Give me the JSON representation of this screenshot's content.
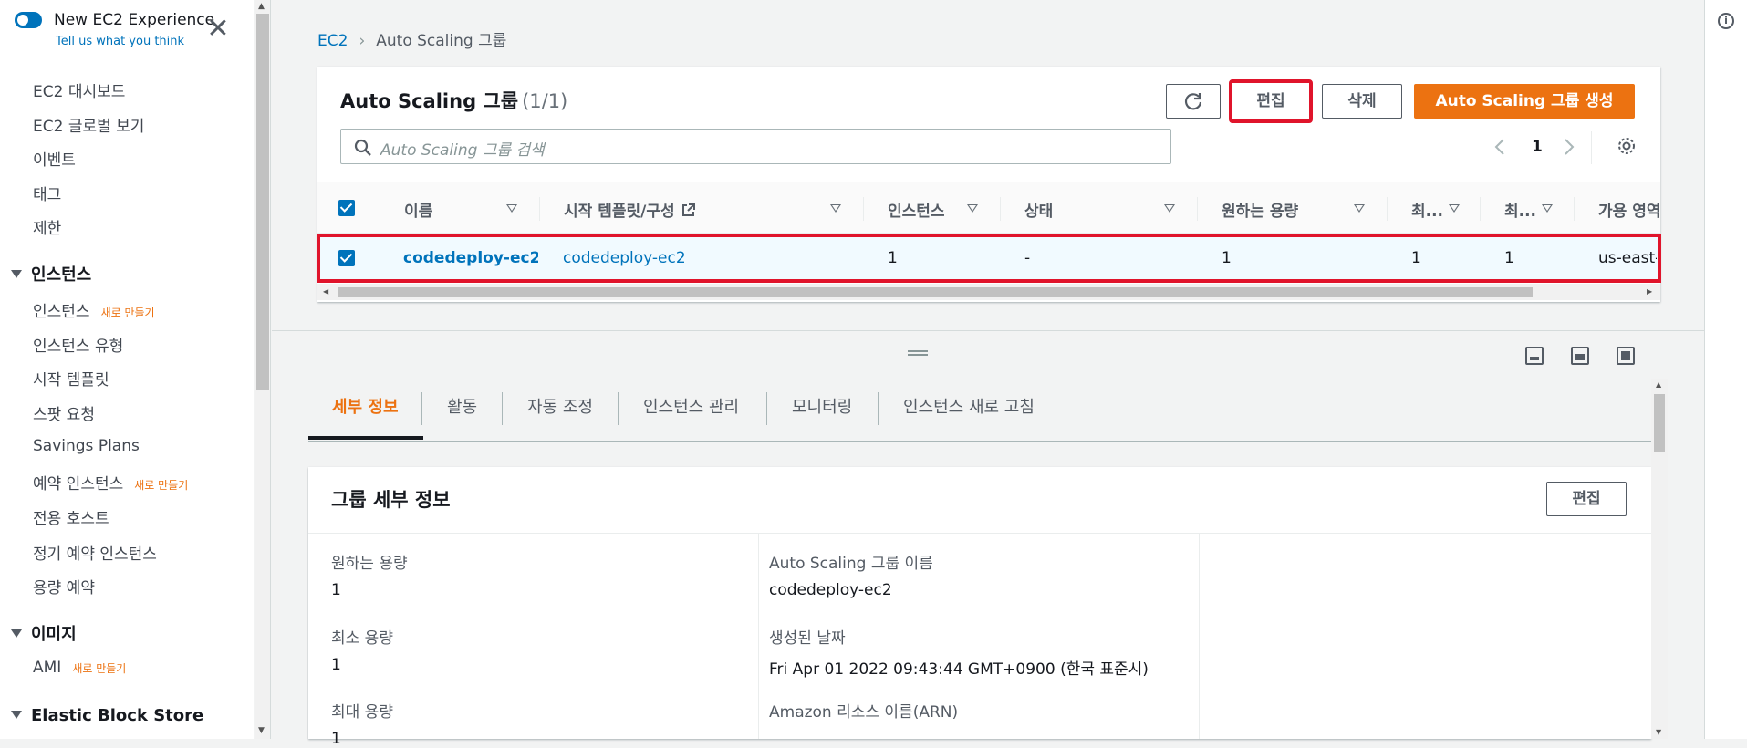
{
  "experience": {
    "title": "New EC2 Experience",
    "subtitle": "Tell us what you think",
    "close": "✕"
  },
  "nav": {
    "top_items": [
      "EC2 대시보드",
      "EC2 글로벌 보기",
      "이벤트",
      "태그",
      "제한"
    ],
    "instances_section": "인스턴스",
    "instances_items": [
      {
        "label": "인스턴스",
        "badge": "새로 만들기"
      },
      {
        "label": "인스턴스 유형",
        "badge": ""
      },
      {
        "label": "시작 템플릿",
        "badge": ""
      },
      {
        "label": "스팟 요청",
        "badge": ""
      },
      {
        "label": "Savings Plans",
        "badge": ""
      },
      {
        "label": "예약 인스턴스",
        "badge": "새로 만들기"
      },
      {
        "label": "전용 호스트",
        "badge": ""
      },
      {
        "label": "정기 예약 인스턴스",
        "badge": ""
      },
      {
        "label": "용량 예약",
        "badge": ""
      }
    ],
    "images_section": "이미지",
    "images_items": [
      {
        "label": "AMI",
        "badge": "새로 만들기"
      }
    ],
    "ebs_section": "Elastic Block Store"
  },
  "breadcrumb": {
    "root": "EC2",
    "current": "Auto Scaling 그룹"
  },
  "panel": {
    "title": "Auto Scaling 그룹",
    "count": "(1/1)",
    "edit_label": "편집",
    "delete_label": "삭제",
    "create_label": "Auto Scaling 그룹 생성",
    "search_placeholder": "Auto Scaling 그룹 검색",
    "page": "1"
  },
  "table": {
    "columns": [
      "이름",
      "시작 템플릿/구성",
      "인스턴스",
      "상태",
      "원하는 용량",
      "최...",
      "최...",
      "가용 영역"
    ],
    "row": [
      "codedeploy-ec2...",
      "codedeploy-ec2",
      "1",
      "-",
      "1",
      "1",
      "1",
      "us-east-"
    ]
  },
  "tabs": [
    "세부 정보",
    "활동",
    "자동 조정",
    "인스턴스 관리",
    "모니터링",
    "인스턴스 새로 고침"
  ],
  "detail": {
    "title": "그룹 세부 정보",
    "edit_label": "편집",
    "col1": [
      {
        "label": "원하는 용량",
        "value": "1"
      },
      {
        "label": "최소 용량",
        "value": "1"
      },
      {
        "label": "최대 용량",
        "value": "1"
      }
    ],
    "col2": [
      {
        "label": "Auto Scaling 그룹 이름",
        "value": "codedeploy-ec2"
      },
      {
        "label": "생성된 날짜",
        "value": "Fri Apr 01 2022 09:43:44 GMT+0900 (한국 표준시)"
      },
      {
        "label": "Amazon 리소스 이름(ARN)",
        "value": ""
      }
    ]
  },
  "colors": {
    "accent": "#ec7211",
    "link": "#0073bb",
    "highlight": "#e0142b"
  }
}
